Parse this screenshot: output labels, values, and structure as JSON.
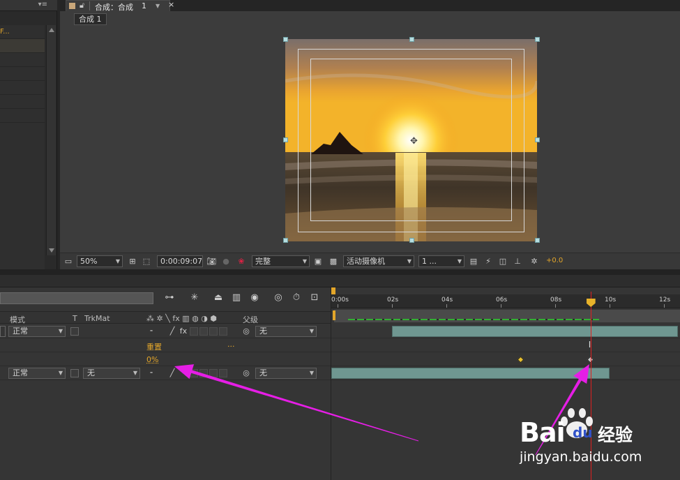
{
  "project_panel": {
    "item_label": "F..."
  },
  "viewer": {
    "tab_title": "合成：合成",
    "tab_number": "1",
    "breadcrumb": "合成 1",
    "toolbar": {
      "zoom": "50%",
      "timecode": "0:00:09:07",
      "resolution": "完整",
      "camera": "活动摄像机",
      "views": "1 ...",
      "exposure": "+0.0"
    }
  },
  "timeline": {
    "columns": {
      "mode": "模式",
      "t": "T",
      "trkmat": "TrkMat",
      "parent": "父级"
    },
    "layers": [
      {
        "mode": "正常",
        "parent": "无"
      },
      {
        "mode": "正常",
        "trkmat": "无",
        "parent": "无"
      }
    ],
    "properties": {
      "reset_label": "重置",
      "reset_more": "...",
      "value": "0%"
    },
    "ruler_labels": [
      "0:00s",
      "02s",
      "04s",
      "06s",
      "08s",
      "10s",
      "12s"
    ],
    "current_time_seconds": 9.3,
    "keyframes_seconds": [
      6.75,
      9.3
    ],
    "layer1_span_seconds": [
      2.0,
      12.5
    ],
    "layer2_span_seconds": [
      0.0,
      10.0
    ]
  },
  "watermark": {
    "brand": "Bai",
    "brand_suffix": "du",
    "product": "经验",
    "url": "jingyan.baidu.com"
  },
  "colors": {
    "accent": "#e3a62a",
    "indicator": "#e02020",
    "annotation_arrow": "#e61ee6",
    "layer_bar": "#6f9791"
  }
}
